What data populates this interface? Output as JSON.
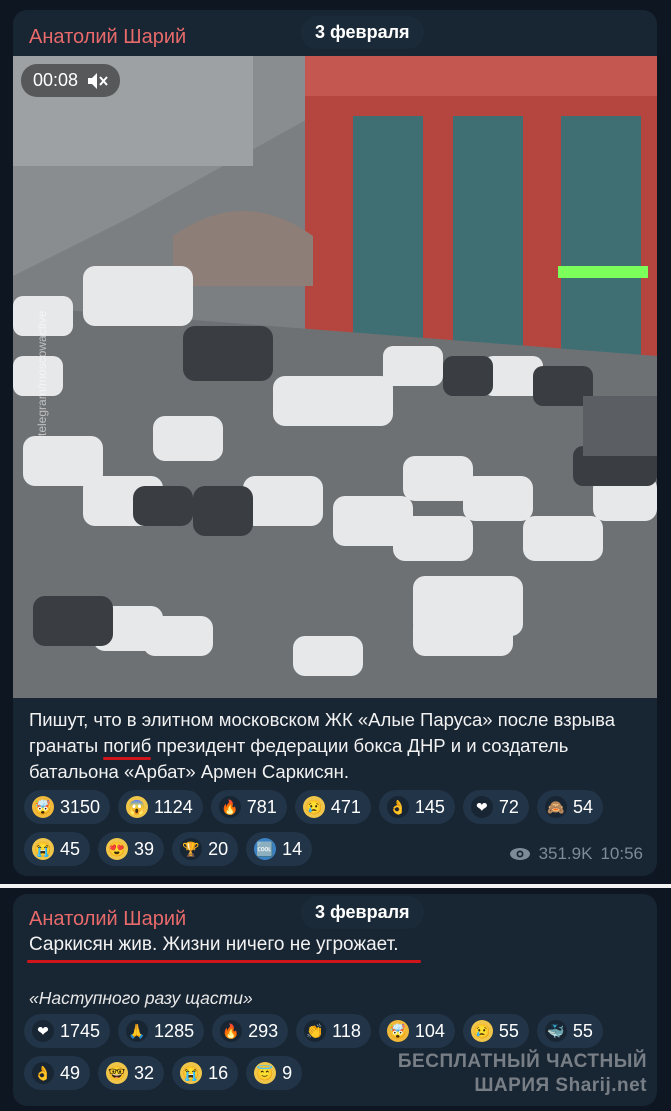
{
  "message1": {
    "author": "Анатолий Шарий",
    "date": "3 февраля",
    "video": {
      "duration": "00:08",
      "watermark": "telegram/moscowactive"
    },
    "text_before": "Пишут, что в элитном московском ЖК «Алые Паруса» после взрыва гранаты ",
    "text_underlined": "погиб",
    "text_after": " президент федерации бокса ДНР и и создатель батальона «Арбат» Армен Саркисян.",
    "reactions": [
      {
        "emoji": "🤯",
        "count": "3150",
        "icon": "exploding-head-icon",
        "bg": "#f0b93a"
      },
      {
        "emoji": "😱",
        "count": "1124",
        "icon": "screaming-face-icon",
        "bg": "#f0c64a"
      },
      {
        "emoji": "🔥",
        "count": "781",
        "icon": "fire-icon",
        "bg": "#182533"
      },
      {
        "emoji": "😢",
        "count": "471",
        "icon": "crying-face-icon",
        "bg": "#f0c64a"
      },
      {
        "emoji": "👌",
        "count": "145",
        "icon": "ok-hand-icon",
        "bg": "#182533"
      },
      {
        "emoji": "❤",
        "count": "72",
        "icon": "red-heart-icon",
        "bg": "#182533"
      },
      {
        "emoji": "🙈",
        "count": "54",
        "icon": "see-no-evil-monkey-icon",
        "bg": "#182533"
      },
      {
        "emoji": "😭",
        "count": "45",
        "icon": "loudly-crying-face-icon",
        "bg": "#f0c64a"
      },
      {
        "emoji": "😍",
        "count": "39",
        "icon": "heart-eyes-icon",
        "bg": "#f0c64a"
      },
      {
        "emoji": "🏆",
        "count": "20",
        "icon": "trophy-icon",
        "bg": "#182533"
      },
      {
        "emoji": "🆒",
        "count": "14",
        "icon": "cool-icon",
        "bg": "#3b82c4"
      }
    ],
    "views": "351.9K",
    "time": "10:56"
  },
  "message2": {
    "author": "Анатолий Шарий",
    "date": "3 февраля",
    "text": "Саркисян жив. Жизни ничего не угрожает.",
    "quote": "«Наступного разу щасти»",
    "reactions": [
      {
        "emoji": "❤",
        "count": "1745",
        "icon": "red-heart-icon",
        "bg": "#182533"
      },
      {
        "emoji": "🙏",
        "count": "1285",
        "icon": "folded-hands-icon",
        "bg": "#182533"
      },
      {
        "emoji": "🔥",
        "count": "293",
        "icon": "fire-icon",
        "bg": "#182533"
      },
      {
        "emoji": "👏",
        "count": "118",
        "icon": "clapping-hands-icon",
        "bg": "#182533"
      },
      {
        "emoji": "🤯",
        "count": "104",
        "icon": "exploding-head-icon",
        "bg": "#f0b93a"
      },
      {
        "emoji": "😢",
        "count": "55",
        "icon": "crying-face-icon",
        "bg": "#f0c64a"
      },
      {
        "emoji": "🐳",
        "count": "55",
        "icon": "whale-icon",
        "bg": "#182533"
      },
      {
        "emoji": "👌",
        "count": "49",
        "icon": "ok-hand-icon",
        "bg": "#182533"
      },
      {
        "emoji": "🤓",
        "count": "32",
        "icon": "nerd-face-icon",
        "bg": "#f0c64a"
      },
      {
        "emoji": "😭",
        "count": "16",
        "icon": "loudly-crying-face-icon",
        "bg": "#f0c64a"
      },
      {
        "emoji": "😇",
        "count": "9",
        "icon": "halo-face-icon",
        "bg": "#f0c64a"
      }
    ],
    "watermark_line1": "БЕСПЛАТНЫЙ ЧАСТНЫЙ",
    "watermark_line2": "ШАРИЯ  Sharij.net"
  },
  "colors": {
    "author": "#e86a6a",
    "bubble": "#182533",
    "background": "#0e1621",
    "underline": "#d0141c"
  }
}
